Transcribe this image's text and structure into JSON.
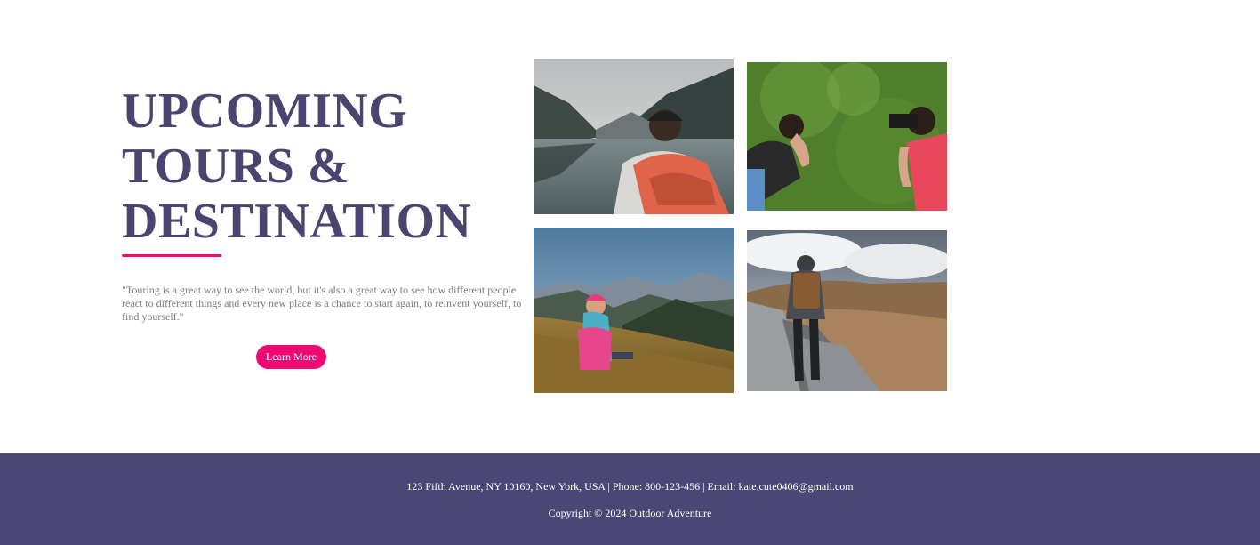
{
  "hero": {
    "headline_line1": "UPCOMING",
    "headline_line2": "TOURS &",
    "headline_line3": "DESTINATION",
    "quote": "\"Touring is a great way to see the world, but it's also a great way to see how different people react to different things and every new place is a chance to start again, to reinvent yourself, to find yourself.\"",
    "cta_label": "Learn More"
  },
  "gallery": {
    "photos": [
      {
        "subject": "hiker-with-backpack-by-lake-photo"
      },
      {
        "subject": "photographers-on-green-grass-photo"
      },
      {
        "subject": "girl-sitting-on-mountain-hill-photo"
      },
      {
        "subject": "hiker-walking-rocky-path-photo"
      }
    ]
  },
  "footer": {
    "address": "123 Fifth Avenue, NY 10160, New York, USA | Phone: 800-123-456 | Email: kate.cute0406@gmail.com",
    "copyright": "Copyright © 2024 Outdoor Adventure"
  },
  "colors": {
    "heading": "#49456f",
    "accent": "#ee0a73",
    "footer_bg": "#4a4774",
    "body_text": "#7a7a7a"
  }
}
